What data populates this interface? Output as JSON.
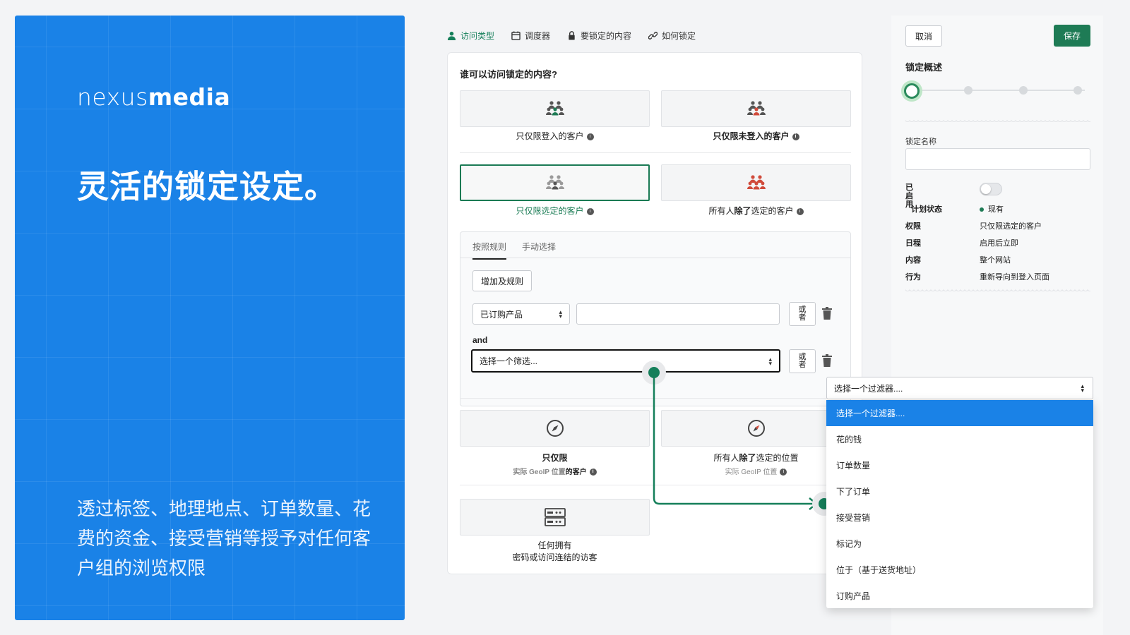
{
  "promo": {
    "logo_light": "nexus",
    "logo_bold": "media",
    "headline": "灵活的锁定设定。",
    "description": "透过标签、地理地点、订单数量、花费的资金、接受营销等授予对任何客户组的浏览权限"
  },
  "steps": [
    {
      "label": "访问类型",
      "icon": "user-icon",
      "active": true
    },
    {
      "label": "调度器",
      "icon": "calendar-icon",
      "active": false
    },
    {
      "label": "要锁定的内容",
      "icon": "lock-icon",
      "active": false
    },
    {
      "label": "如何锁定",
      "icon": "link-icon",
      "active": false
    }
  ],
  "card": {
    "question": "谁可以访问锁定的内容?",
    "options": [
      {
        "label": "只仅限登入的客户"
      },
      {
        "label": "只仅限未登入的客户"
      },
      {
        "label": "只仅限选定的客户"
      },
      {
        "label_prefix": "所有人",
        "label_bold": "除了",
        "label_suffix": "选定的客户"
      }
    ],
    "rules": {
      "tabs": [
        "按照规则",
        "手动选择"
      ],
      "add_rule": "增加及规则",
      "rule1_select": "已订购产品",
      "or_label": "或者",
      "and_label": "and",
      "rule2_select": "选择一个筛选..."
    },
    "geo_options": [
      {
        "title": "只仅限",
        "sub_gray": "实际 GeoIP 位置",
        "sub_rest": "的客户"
      },
      {
        "title_prefix": "所有人",
        "title_bold": "除了",
        "title_suffix": "选定的位置",
        "sub_gray": "实际 GeoIP 位置"
      }
    ],
    "password_option": {
      "line1": "任何拥有",
      "line2": "密码或访问连结的访客"
    }
  },
  "sidebar": {
    "cancel": "取消",
    "save": "保存",
    "overview_title": "锁定概述",
    "name_label": "锁定名称",
    "enabled_label": "已启用",
    "rows": [
      {
        "k": "计划状态",
        "v": "现有"
      },
      {
        "k": "权限",
        "v": "只仅限选定的客户"
      },
      {
        "k": "日程",
        "v": "启用后立即"
      },
      {
        "k": "内容",
        "v": "整个网站"
      },
      {
        "k": "行为",
        "v": "重新导向到登入页面"
      }
    ]
  },
  "dropdown": {
    "selected": "选择一个过滤器....",
    "items": [
      "选择一个过滤器....",
      "花的钱",
      "订单数量",
      "下了订单",
      "接受营销",
      "标记为",
      "位于（基于送货地址）",
      "订购产品"
    ]
  },
  "colors": {
    "brand_blue": "#1a82e7",
    "accent_green": "#1e7b55"
  }
}
